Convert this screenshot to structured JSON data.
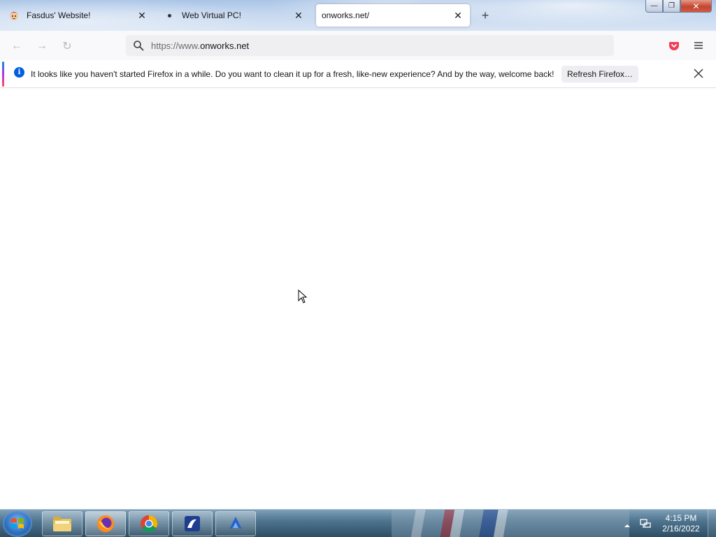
{
  "window": {
    "minimize_glyph": "—",
    "restore_glyph": "❐",
    "close_glyph": "✕"
  },
  "tabs": [
    {
      "title": "Fasdus' Website!",
      "icon": "cartoon-face-icon",
      "close": "✕"
    },
    {
      "title": "Web Virtual PC!",
      "icon": "dot-icon",
      "close": "✕"
    },
    {
      "title": "onworks.net/",
      "icon": "",
      "close": "✕",
      "active": true
    }
  ],
  "new_tab": "+",
  "nav": {
    "back": "←",
    "forward": "→",
    "reload": "↻",
    "url_prefix": "https://www.",
    "url_host": "onworks.net"
  },
  "notification": {
    "text": "It looks like you haven't started Firefox in a while. Do you want to clean it up for a fresh, like-new experience? And by the way, welcome back!",
    "button": "Refresh Firefox…",
    "accent_colors": [
      "#0090ed",
      "#b833e1",
      "#ff4f5e"
    ]
  },
  "taskbar": {
    "apps": [
      "windows-explorer",
      "firefox",
      "chrome",
      "app-blue-1",
      "app-blue-2"
    ],
    "clock_time": "4:15 PM",
    "clock_date": "2/16/2022"
  },
  "colors": {
    "active_tab_bg": "#ffffff",
    "urlbar_bg": "#efeff2",
    "pocket_red": "#ef4056",
    "info_blue": "#0060df"
  }
}
